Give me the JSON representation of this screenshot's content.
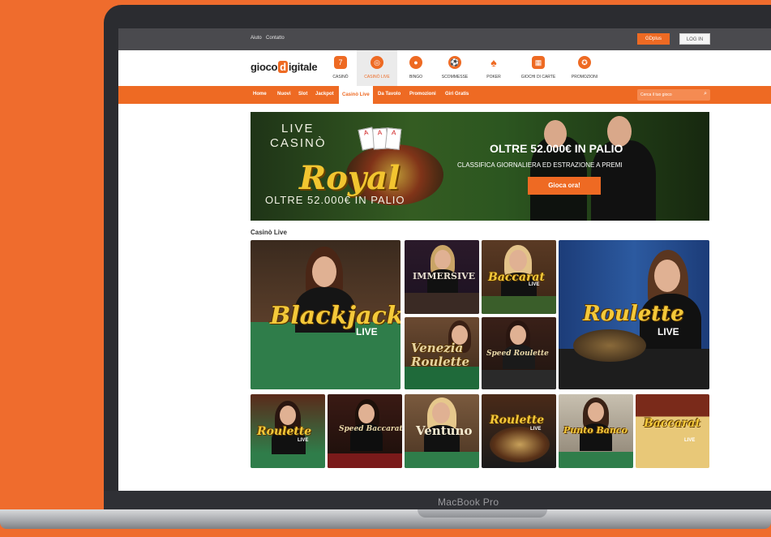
{
  "topbar": {
    "links": [
      "Aiuto",
      "Contatto"
    ],
    "signup_label": "GDplus",
    "login_label": "LOG IN"
  },
  "header": {
    "logo": {
      "left": "gioco",
      "mid": "d",
      "right": "igitale"
    },
    "categories": [
      {
        "label": "CASINÒ",
        "icon": "slot-777-icon"
      },
      {
        "label": "CASINÒ LIVE",
        "icon": "live-chip-icon"
      },
      {
        "label": "BINGO",
        "icon": "bingo-ball-icon"
      },
      {
        "label": "SCOMMESSE",
        "icon": "football-icon"
      },
      {
        "label": "POKER",
        "icon": "spade-icon"
      },
      {
        "label": "GIOCHI DI CARTE",
        "icon": "cards-icon"
      },
      {
        "label": "PROMOZIONI",
        "icon": "ribbon-icon"
      }
    ]
  },
  "nav": {
    "items": [
      "Home",
      "Nuovi",
      "Slot",
      "Jackpot",
      "Casinò Live",
      "Da Tavolo",
      "Promozioni",
      "Giri Gratis"
    ],
    "active": "Casinò Live",
    "search_placeholder": "Cerca il tuo gioco"
  },
  "banner": {
    "live": "LIVE",
    "casino": "CASINÒ",
    "royal": "Royal",
    "bottom": "OLTRE 52.000€ IN PALIO",
    "headline": "OLTRE 52.000€ IN PALIO",
    "subline": "CLASSIFICA GIORNALIERA ED ESTRAZIONE A PREMI",
    "cta": "Gioca ora!",
    "cards": [
      "A",
      "A",
      "A"
    ]
  },
  "section_title": "Casinò Live",
  "games": {
    "blackjack": {
      "title": "Blackjack",
      "sub": "LIVE"
    },
    "immersive": {
      "title": "IMMERSIVE"
    },
    "baccarat1": {
      "title": "Baccarat",
      "sub": "LIVE"
    },
    "roulette_big": {
      "title": "Roulette",
      "sub": "LIVE"
    },
    "venezia": {
      "title": "Venezia Roulette"
    },
    "speed_roulette": {
      "title": "Speed Roulette"
    },
    "roulette_small": {
      "title": "Roulette",
      "sub": "LIVE"
    },
    "speed_baccarat": {
      "title": "Speed Baccarat"
    },
    "ventuno": {
      "title": "Ventuno"
    },
    "auto_roulette": {
      "title": "Roulette",
      "sub": "LIVE"
    },
    "punto_banco": {
      "title": "Punto Banco"
    },
    "baccarat_squeeze": {
      "title": "Baccarat",
      "sub": "LIVE"
    }
  },
  "device_label": "MacBook Pro",
  "colors": {
    "accent": "#ee6a23",
    "background": "#ef6c2d",
    "felt": "#2f7d4a"
  }
}
